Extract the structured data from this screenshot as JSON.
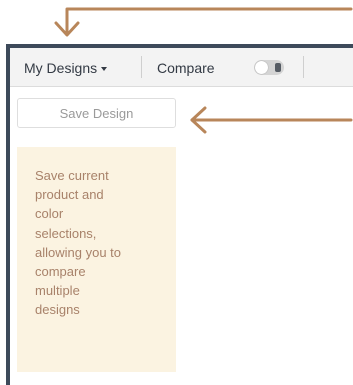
{
  "toolbar": {
    "my_designs_label": "My Designs",
    "compare_label": "Compare",
    "compare_enabled": false
  },
  "sidebar": {
    "save_button_label": "Save Design",
    "info_text": "Save current\nproduct and\ncolor\nselections,\nallowing you to\ncompare\nmultiple\ndesigns"
  },
  "colors": {
    "annotation_arrow": "#b8865a",
    "frame_border": "#3d4a5a",
    "info_background": "#fbf3e1",
    "info_text": "#a8826a"
  },
  "icons": {
    "dropdown": "caret-down-icon",
    "toggle": "toggle-switch-icon",
    "annotation": "arrow-icon"
  }
}
